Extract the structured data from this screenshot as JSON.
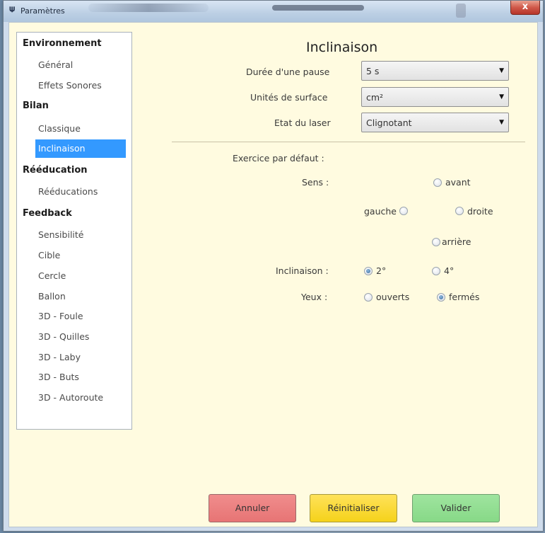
{
  "window": {
    "title": "Paramètres",
    "app_icon_glyph": "𝚿",
    "close_glyph": "x"
  },
  "sidebar": {
    "categories": [
      {
        "label": "Environnement",
        "items": [
          "Général",
          "Effets Sonores"
        ]
      },
      {
        "label": "Bilan",
        "items": [
          "Classique",
          "Inclinaison"
        ]
      },
      {
        "label": "Rééducation",
        "items": [
          "Rééducations"
        ]
      },
      {
        "label": "Feedback",
        "items": [
          "Sensibilité",
          "Cible",
          "Cercle",
          "Ballon",
          "3D - Foule",
          "3D - Quilles",
          "3D - Laby",
          "3D - Buts",
          "3D - Autoroute"
        ]
      }
    ],
    "selected": "Inclinaison",
    "selection_color": "#3399ff"
  },
  "panel": {
    "title": "Inclinaison",
    "settings": [
      {
        "label": "Durée d'une pause",
        "value": "5 s"
      },
      {
        "label": "Unités de surface",
        "value": "cm²"
      },
      {
        "label": "Etat du laser",
        "value": "Clignotant"
      }
    ],
    "default_exercise_label": "Exercice par défaut :",
    "sens": {
      "label": "Sens :",
      "options": {
        "avant": "avant",
        "gauche": "gauche",
        "droite": "droite",
        "arriere": "arrière"
      }
    },
    "inclinaison": {
      "label": "Inclinaison :",
      "options": [
        "2°",
        "4°"
      ],
      "selected": "2°"
    },
    "yeux": {
      "label": "Yeux :",
      "options": [
        "ouverts",
        "fermés"
      ],
      "selected": "fermés"
    }
  },
  "buttons": {
    "cancel": "Annuler",
    "reset": "Réinitialiser",
    "validate": "Valider"
  },
  "colors": {
    "background": "#fffbe0",
    "cancel": "#e77474",
    "reset": "#f5d21a",
    "validate": "#87d987"
  },
  "icons": {
    "combo_arrow": "chevron-down-icon",
    "close": "close-icon"
  }
}
